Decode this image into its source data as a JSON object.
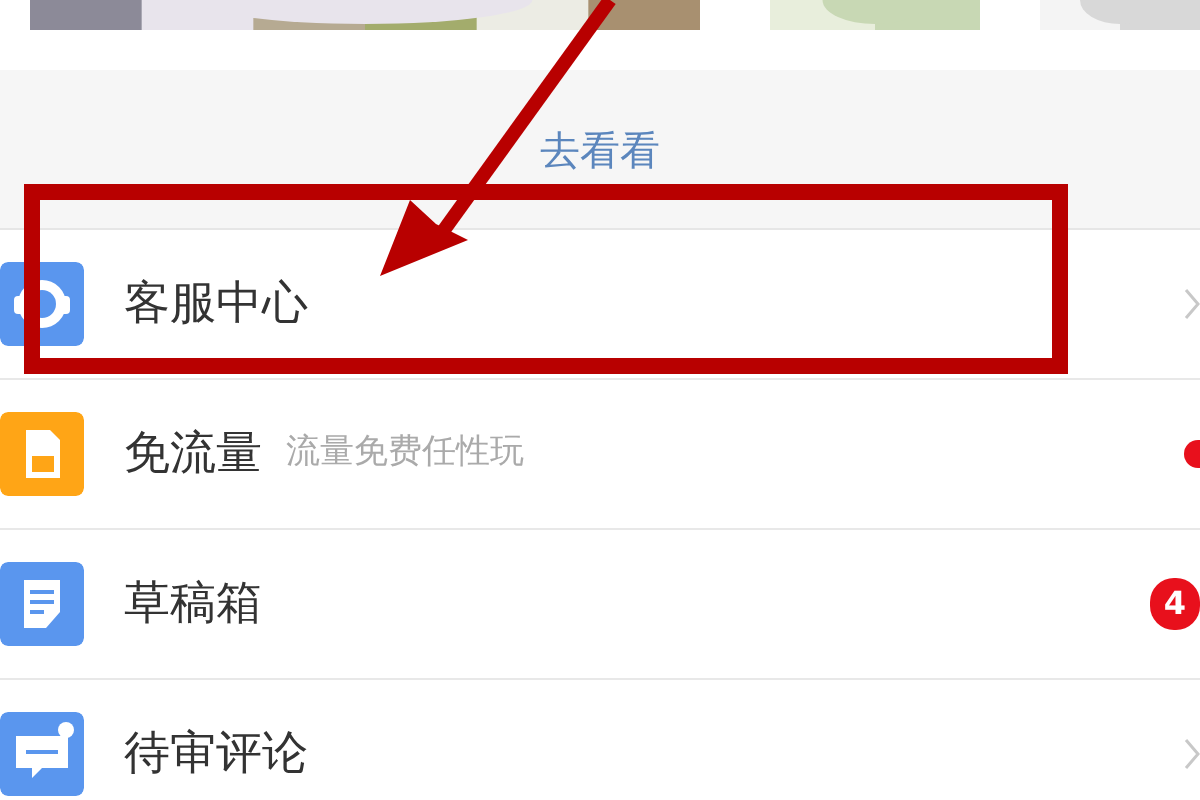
{
  "more_link": "去看看",
  "menu": [
    {
      "kind": "chevron",
      "label": "客服中心"
    },
    {
      "kind": "dot",
      "label": "免流量",
      "subtitle": "流量免费任性玩",
      "color": "#e8101c"
    },
    {
      "kind": "badge",
      "label": "草稿箱",
      "badge": "4"
    },
    {
      "kind": "chevron",
      "label": "待审评论"
    }
  ]
}
